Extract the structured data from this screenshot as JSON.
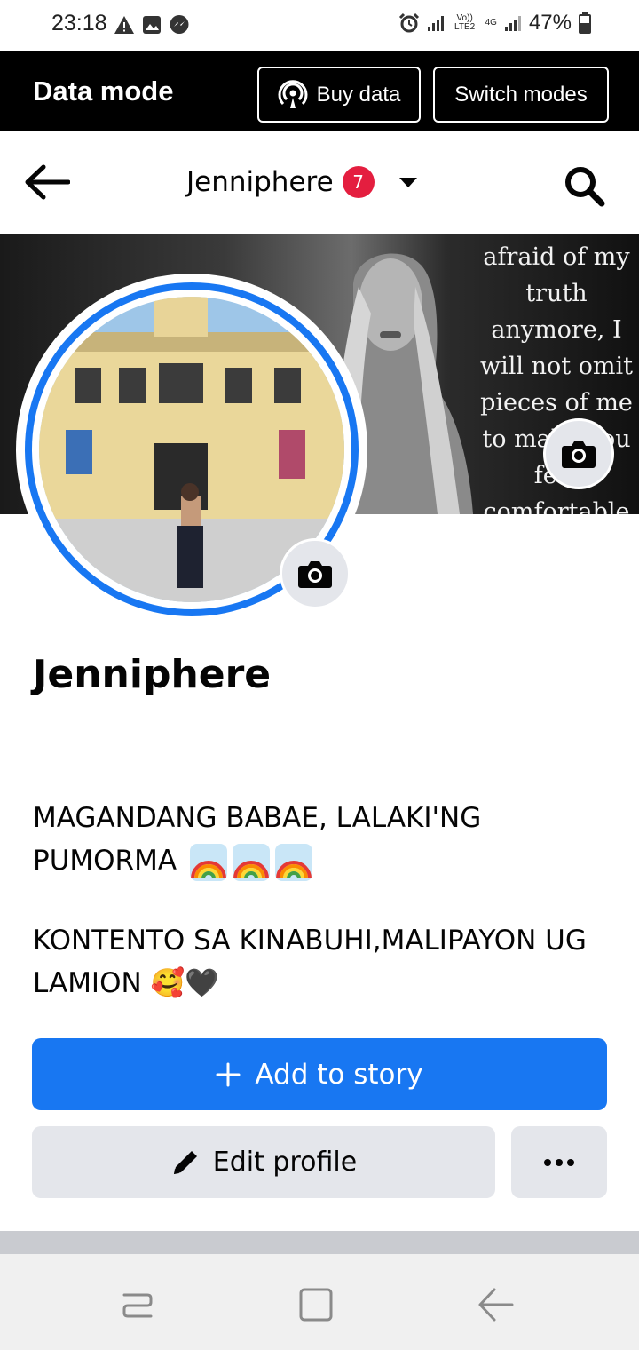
{
  "status_bar": {
    "time": "23:18",
    "battery": "47%",
    "network_label_1": "Vo)) LTE2",
    "network_label_2": "4G"
  },
  "data_mode": {
    "title": "Data mode",
    "buy_data": "Buy data",
    "switch_modes": "Switch modes"
  },
  "nav": {
    "title": "Jenniphere",
    "notification_count": "7"
  },
  "cover": {
    "quote": "afraid of my truth anymore, I will not omit pieces of me to make you feel comfortable"
  },
  "profile": {
    "name": "Jenniphere",
    "bio_line1": "MAGANDANG BABAE, LALAKI'NG PUMORMA",
    "bio_line2": "KONTENTO SA KINABUHI,MALIPAYON UG LAMION",
    "bio_line2_emoji": "🥰🖤"
  },
  "actions": {
    "add_story": "Add to story",
    "edit_profile": "Edit profile"
  },
  "colors": {
    "accent": "#1877f2",
    "badge": "#e41e3f",
    "button_gray": "#e4e6eb"
  }
}
